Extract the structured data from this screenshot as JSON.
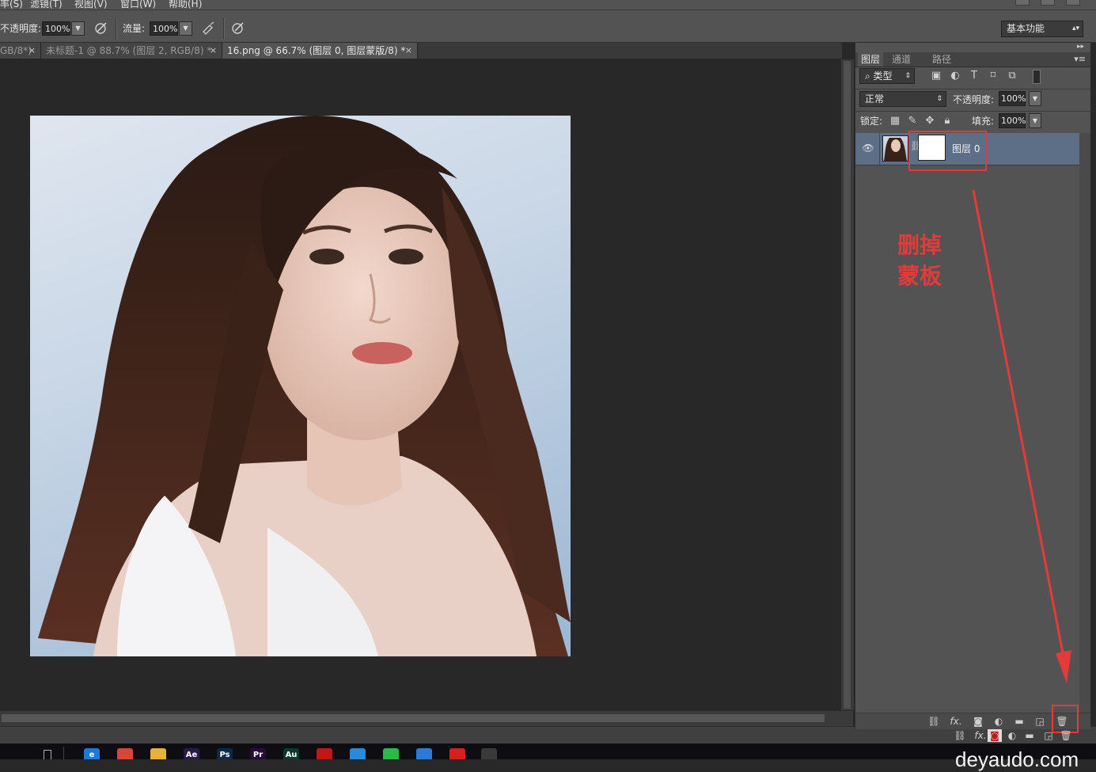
{
  "menubar": {
    "items": [
      "率(S)",
      "滤镜(T)",
      "视图(V)",
      "窗口(W)",
      "帮助(H)"
    ]
  },
  "options": {
    "opacity_label": "不透明度:",
    "opacity_value": "100%",
    "flow_label": "流量:",
    "flow_value": "100%",
    "workspace": "基本功能"
  },
  "tabs": [
    {
      "title": "GB/8*)",
      "close": "×"
    },
    {
      "title": "未标题-1 @ 88.7% (图层 2, RGB/8) *",
      "close": "×"
    },
    {
      "title": "16.png @ 66.7% (图层 0, 图层蒙版/8) *",
      "close": "×"
    }
  ],
  "layers_panel": {
    "tabs": [
      "图层",
      "通道",
      "路径"
    ],
    "filter_kind": "类型",
    "blend_mode": "正常",
    "opacity_label": "不透明度:",
    "opacity_value": "100%",
    "lock_label": "锁定:",
    "fill_label": "填充:",
    "fill_value": "100%",
    "layer": {
      "name": "图层 0"
    },
    "footer_fx": "fx."
  },
  "annotation": {
    "line1": "删掉",
    "line2": "蒙板",
    "color": "#e53a3a"
  },
  "taskbar": {
    "apps": [
      {
        "name": "edge",
        "glyph": "e",
        "color": "#1e78d4"
      },
      {
        "name": "chrome",
        "glyph": "",
        "color": "#d8453a"
      },
      {
        "name": "explorer",
        "glyph": "",
        "color": "#e6b33a"
      },
      {
        "name": "after-effects",
        "glyph": "Ae",
        "color": "#2a1a4a"
      },
      {
        "name": "photoshop",
        "glyph": "Ps",
        "color": "#0a2a4a"
      },
      {
        "name": "premiere",
        "glyph": "Pr",
        "color": "#2a0a3a"
      },
      {
        "name": "audition",
        "glyph": "Au",
        "color": "#0a3a2a"
      },
      {
        "name": "recorder",
        "glyph": "",
        "color": "#c01818"
      },
      {
        "name": "messenger",
        "glyph": "",
        "color": "#2a8ad8"
      },
      {
        "name": "wechat",
        "glyph": "",
        "color": "#2db84a"
      },
      {
        "name": "feishu",
        "glyph": "",
        "color": "#2a7ad8"
      },
      {
        "name": "pinduoduo",
        "glyph": "",
        "color": "#d81e1e"
      },
      {
        "name": "photos",
        "glyph": "",
        "color": "#3a3a3a"
      }
    ]
  },
  "watermark": "deyaudo.com"
}
